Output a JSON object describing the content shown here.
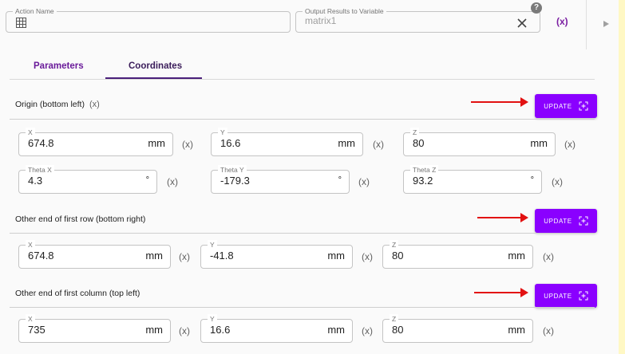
{
  "header": {
    "action_name_label": "Action Name",
    "action_name_value": "",
    "output_label": "Output Results to Variable",
    "output_value": "matrix1",
    "help_icon": "help-circle-icon",
    "clear_icon": "close-icon",
    "var_toggle_label": "(x)",
    "run_icon": "play-icon"
  },
  "tabs": [
    {
      "label": "Parameters",
      "active": false
    },
    {
      "label": "Coordinates",
      "active": true
    }
  ],
  "var_marker": "(x)",
  "update_label": "UPDATE",
  "sections": [
    {
      "title": "Origin (bottom left)",
      "rows": [
        [
          {
            "label": "X",
            "value": "674.8",
            "unit": "mm"
          },
          {
            "label": "Y",
            "value": "16.6",
            "unit": "mm"
          },
          {
            "label": "Z",
            "value": "80",
            "unit": "mm"
          }
        ],
        [
          {
            "label": "Theta X",
            "value": "4.3",
            "unit": "°"
          },
          {
            "label": "Theta Y",
            "value": "-179.3",
            "unit": "°"
          },
          {
            "label": "Theta Z",
            "value": "93.2",
            "unit": "°"
          }
        ]
      ]
    },
    {
      "title": "Other end of first row (bottom right)",
      "rows": [
        [
          {
            "label": "X",
            "value": "674.8",
            "unit": "mm"
          },
          {
            "label": "Y",
            "value": "-41.8",
            "unit": "mm"
          },
          {
            "label": "Z",
            "value": "80",
            "unit": "mm"
          }
        ]
      ]
    },
    {
      "title": "Other end of first column (top left)",
      "rows": [
        [
          {
            "label": "X",
            "value": "735",
            "unit": "mm"
          },
          {
            "label": "Y",
            "value": "16.6",
            "unit": "mm"
          },
          {
            "label": "Z",
            "value": "80",
            "unit": "mm"
          }
        ]
      ]
    }
  ],
  "colors": {
    "accent": "#8a00ff",
    "tab_text": "#6a1b9a",
    "annotation_arrow": "#e21111"
  }
}
